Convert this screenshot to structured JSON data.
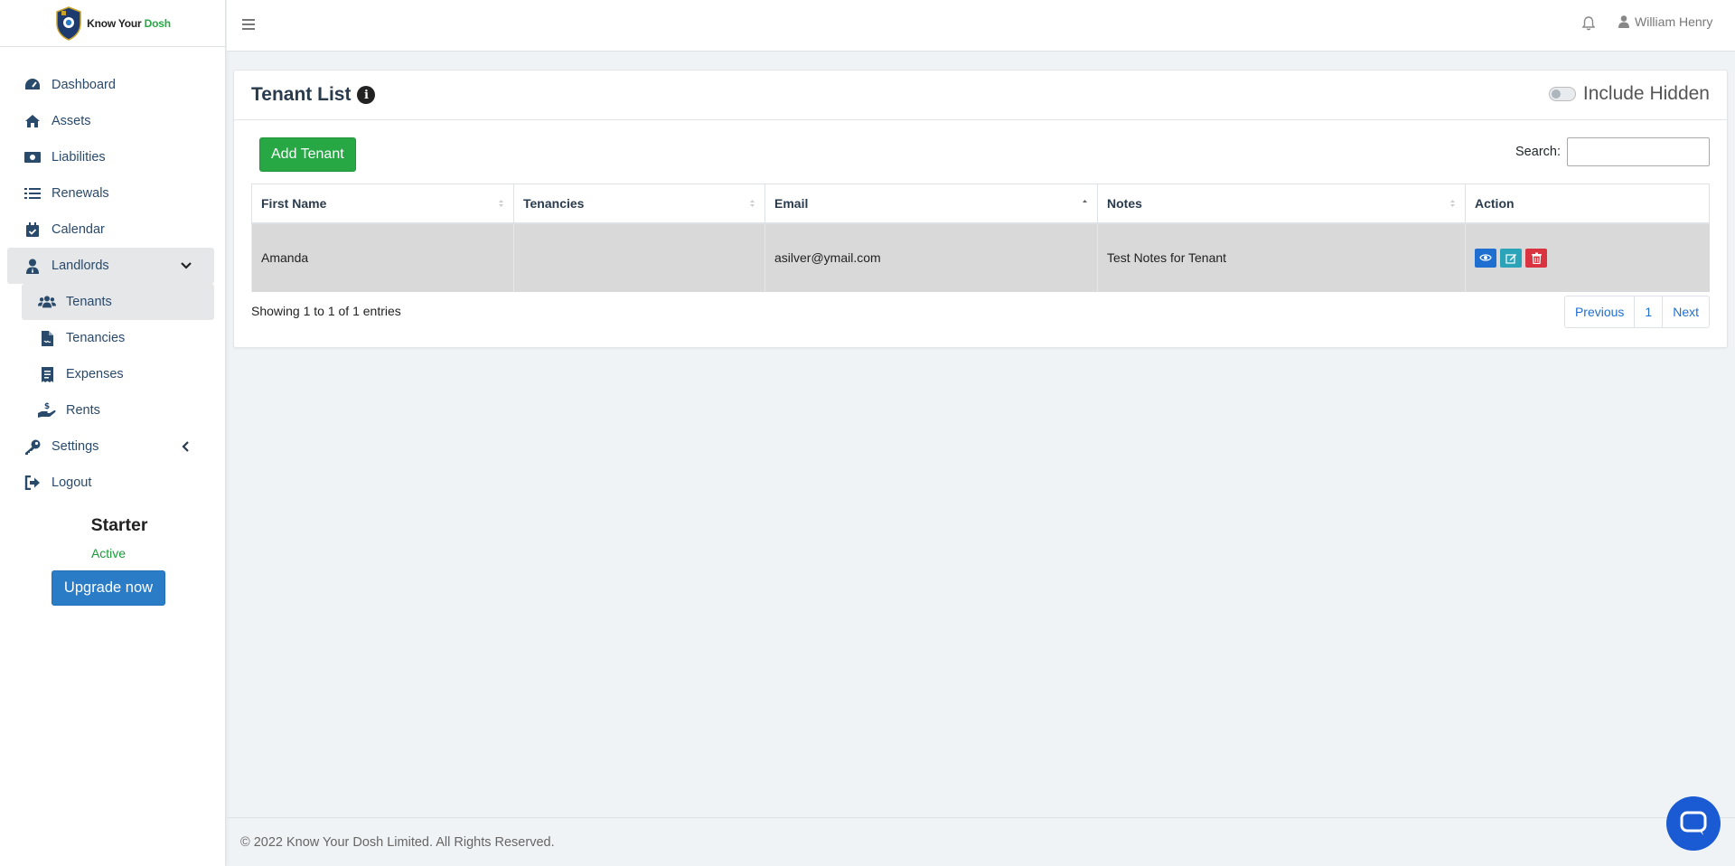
{
  "brand": {
    "name_part1": "Know Your ",
    "name_part2": "Dosh"
  },
  "sidebar": {
    "items": [
      {
        "label": "Dashboard",
        "icon": "tachometer-icon"
      },
      {
        "label": "Assets",
        "icon": "home-icon"
      },
      {
        "label": "Liabilities",
        "icon": "money-icon"
      },
      {
        "label": "Renewals",
        "icon": "list-icon"
      },
      {
        "label": "Calendar",
        "icon": "calendar-check-icon"
      },
      {
        "label": "Landlords",
        "icon": "user-tie-icon",
        "expanded": true
      },
      {
        "label": "Settings",
        "icon": "key-icon"
      },
      {
        "label": "Logout",
        "icon": "sign-out-icon"
      }
    ],
    "subitems": [
      {
        "label": "Tenants",
        "icon": "users-icon",
        "active": true
      },
      {
        "label": "Tenancies",
        "icon": "file-contract-icon"
      },
      {
        "label": "Expenses",
        "icon": "receipt-icon"
      },
      {
        "label": "Rents",
        "icon": "hand-dollar-icon"
      }
    ],
    "plan": {
      "name": "Starter",
      "status": "Active",
      "upgrade_label": "Upgrade now"
    }
  },
  "topbar": {
    "user_name": "William Henry"
  },
  "card": {
    "title": "Tenant List",
    "include_hidden_label": "Include Hidden",
    "include_hidden_on": false,
    "add_button": "Add Tenant",
    "search_label": "Search:",
    "search_value": ""
  },
  "table": {
    "columns": [
      "First Name",
      "Tenancies",
      "Email",
      "Notes",
      "Action"
    ],
    "rows": [
      {
        "first_name": "Amanda",
        "tenancies": "",
        "email": "asilver@ymail.com",
        "notes": "Test Notes for Tenant"
      }
    ]
  },
  "pagination": {
    "info": "Showing 1 to 1 of 1 entries",
    "previous": "Previous",
    "page": "1",
    "next": "Next"
  },
  "footer": {
    "text": "© 2022 Know Your Dosh Limited. All Rights Reserved."
  },
  "colors": {
    "primary": "#1f6fd0",
    "success": "#28a745",
    "danger": "#d9343f",
    "info": "#2ba3b8",
    "sidebar_text": "#2a4a6b"
  }
}
